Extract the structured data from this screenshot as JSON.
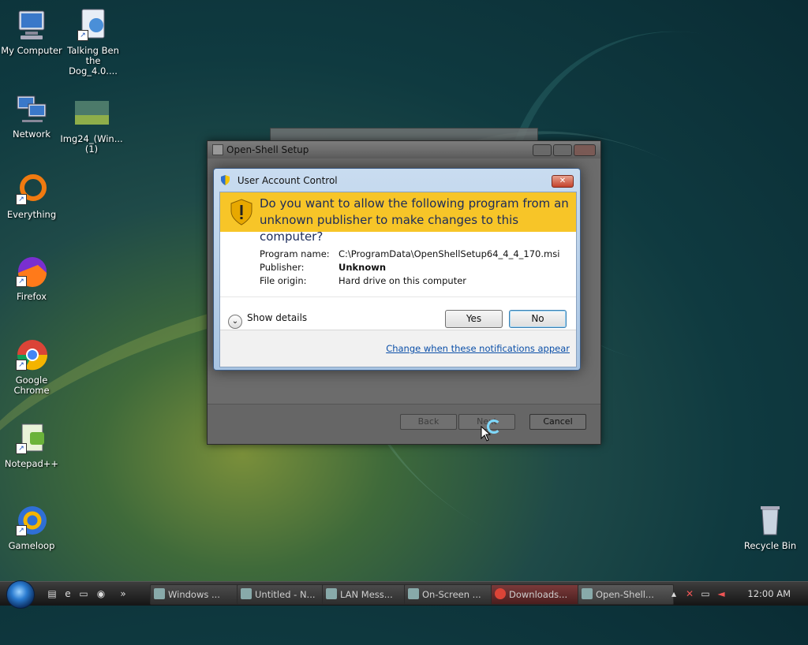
{
  "desktop": {
    "icons": [
      {
        "label": "My Computer",
        "icon": "computer-icon"
      },
      {
        "label": "Talking Ben the Dog_4.0....",
        "icon": "app-shortcut-icon"
      },
      {
        "label": "Network",
        "icon": "network-icon"
      },
      {
        "label": "Img24_(Win...(1)",
        "icon": "image-file-icon"
      },
      {
        "label": "Everything",
        "icon": "everything-icon"
      },
      {
        "label": "Firefox",
        "icon": "firefox-icon"
      },
      {
        "label": "Google Chrome",
        "icon": "chrome-icon"
      },
      {
        "label": "Notepad++",
        "icon": "notepadpp-icon"
      },
      {
        "label": "Gameloop",
        "icon": "gameloop-icon"
      },
      {
        "label": "Recycle Bin",
        "icon": "recycle-bin-icon"
      }
    ]
  },
  "setup_window": {
    "title": "Open-Shell Setup",
    "buttons": {
      "back": "Back",
      "next": "Next",
      "cancel": "Cancel"
    }
  },
  "uac": {
    "title": "User Account Control",
    "question_line1": "Do you want to allow the following program from an",
    "question_line2": "unknown publisher to make changes to this computer?",
    "program_name_label": "Program name:",
    "program_name_value": "C:\\ProgramData\\OpenShellSetup64_4_4_170.msi",
    "publisher_label": "Publisher:",
    "publisher_value": "Unknown",
    "file_origin_label": "File origin:",
    "file_origin_value": "Hard drive on this computer",
    "show_details": "Show details",
    "yes": "Yes",
    "no": "No",
    "change_link": "Change when these notifications appear",
    "accent_color": "#f7c528"
  },
  "taskbar": {
    "tasks": [
      "Windows ...",
      "Untitled - N...",
      "LAN Mess...",
      "On-Screen ...",
      "Downloads...",
      "Open-Shell..."
    ],
    "clock": "12:00 AM"
  }
}
